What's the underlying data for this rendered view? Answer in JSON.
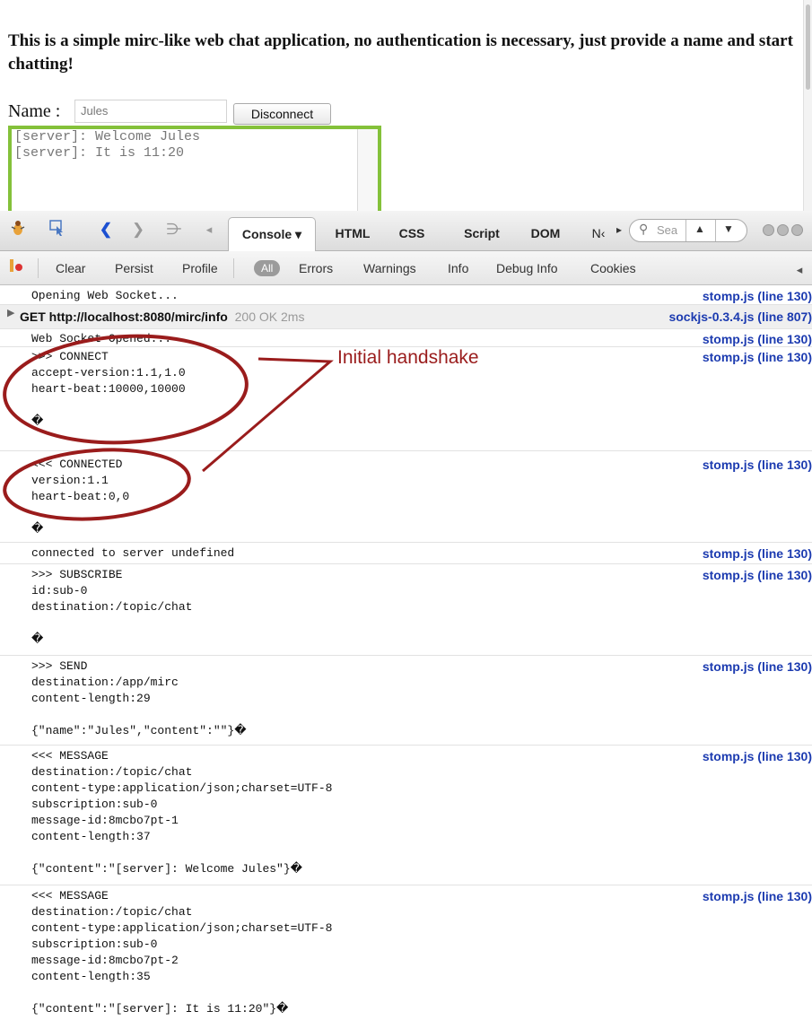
{
  "page": {
    "intro": "This is a simple mirc-like web chat application, no authentication is necessary, just provide a name and start chatting!",
    "name_label": "Name :",
    "name_value": "Jules",
    "disconnect_label": "Disconnect",
    "chat_lines": [
      "[server]: Welcome Jules",
      "[server]: It is 11:20"
    ]
  },
  "devtools": {
    "icons": [
      "firebug-icon",
      "inspect-icon",
      "back-arrow-icon",
      "forward-arrow-icon",
      "indent-icon",
      "scroll-left-icon"
    ],
    "panel_tabs": [
      {
        "label": "Console ▾",
        "active": true
      },
      {
        "label": "HTML"
      },
      {
        "label": "CSS"
      },
      {
        "label": "Script"
      },
      {
        "label": "DOM"
      },
      {
        "label": "N‹"
      }
    ],
    "search_placeholder": "Sea",
    "toolbar2": {
      "clear": "Clear",
      "persist": "Persist",
      "profile": "Profile",
      "filters": [
        "All",
        "Errors",
        "Warnings",
        "Info",
        "Debug Info",
        "Cookies"
      ]
    },
    "entries": [
      {
        "text": "Opening Web Socket...",
        "source": "stomp.js (line 130)"
      },
      {
        "url": "GET http://localhost:8080/mirc/info",
        "status": "200 OK 2ms",
        "source": "sockjs-0.3.4.js (line 807)",
        "type": "net"
      },
      {
        "text": "Web Socket Opened...",
        "source": "stomp.js (line 130)"
      },
      {
        "text": ">>> CONNECT\naccept-version:1.1,1.0\nheart-beat:10000,10000\n\n�",
        "source": "stomp.js (line 130)"
      },
      {
        "text": "<<< CONNECTED\nversion:1.1\nheart-beat:0,0\n\n�",
        "source": "stomp.js (line 130)"
      },
      {
        "text": "connected to server undefined",
        "source": "stomp.js (line 130)"
      },
      {
        "text": ">>> SUBSCRIBE\nid:sub-0\ndestination:/topic/chat\n\n�",
        "source": "stomp.js (line 130)"
      },
      {
        "text": ">>> SEND\ndestination:/app/mirc\ncontent-length:29\n\n{\"name\":\"Jules\",\"content\":\"\"}�",
        "source": "stomp.js (line 130)"
      },
      {
        "text": "<<< MESSAGE\ndestination:/topic/chat\ncontent-type:application/json;charset=UTF-8\nsubscription:sub-0\nmessage-id:8mcbo7pt-1\ncontent-length:37\n\n{\"content\":\"[server]: Welcome Jules\"}�",
        "source": "stomp.js (line 130)"
      },
      {
        "text": "<<< MESSAGE\ndestination:/topic/chat\ncontent-type:application/json;charset=UTF-8\nsubscription:sub-0\nmessage-id:8mcbo7pt-2\ncontent-length:35\n\n{\"content\":\"[server]: It is 11:20\"}�",
        "source": "stomp.js (line 130)"
      }
    ]
  },
  "annotation": {
    "label": "Initial handshake",
    "color": "#9a1c1c"
  },
  "colors": {
    "chat_border": "#84c13a",
    "source_link": "#1c3bb0"
  }
}
